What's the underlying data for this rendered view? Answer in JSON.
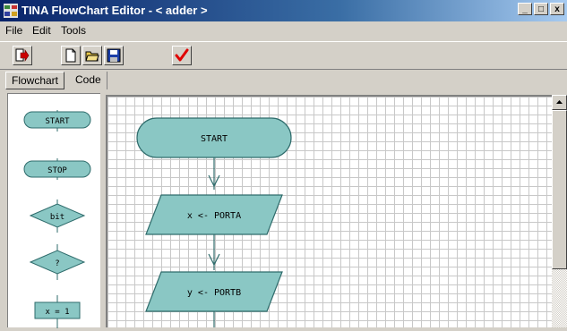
{
  "window": {
    "title": "TINA FlowChart Editor  -  < adder >",
    "controls": {
      "minimize": "_",
      "maximize": "□",
      "close": "x"
    }
  },
  "menu": [
    {
      "label": "File"
    },
    {
      "label": "Edit"
    },
    {
      "label": "Tools"
    }
  ],
  "toolbar": {
    "icons": [
      "exit-run-icon",
      "new-document-icon",
      "open-folder-icon",
      "save-disk-icon",
      "check-mark-icon"
    ],
    "colors": {
      "exit_arrow": "#cc0000",
      "check": "#e00000",
      "folder": "#e8c84a",
      "disk": "#1c3fa8"
    }
  },
  "tabs": [
    {
      "label": "Flowchart",
      "active": true
    },
    {
      "label": "Code",
      "active": false
    }
  ],
  "palette": {
    "items": [
      {
        "shape": "terminal",
        "label": "START"
      },
      {
        "shape": "terminal",
        "label": "STOP"
      },
      {
        "shape": "decision",
        "label": "bit"
      },
      {
        "shape": "decision",
        "label": "?"
      },
      {
        "shape": "process",
        "label": "x = 1"
      }
    ]
  },
  "flowchart": {
    "fill": "#8ac7c4",
    "nodes": [
      {
        "shape": "terminal",
        "label": "START"
      },
      {
        "shape": "io",
        "label": "x <- PORTA"
      },
      {
        "shape": "io",
        "label": "y <- PORTB"
      }
    ]
  },
  "colors": {
    "shape_fill": "#8ac7c4",
    "shape_stroke": "#2e6b6b",
    "grid": "#c8c8c8",
    "title_bar": "#0a246a"
  }
}
